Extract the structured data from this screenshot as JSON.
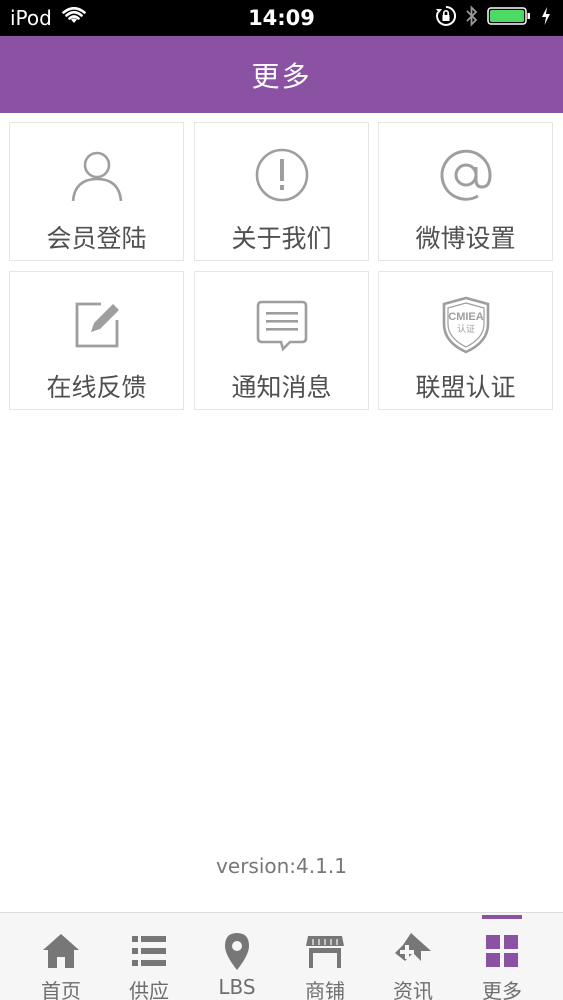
{
  "status_bar": {
    "carrier": "iPod",
    "time": "14:09"
  },
  "header": {
    "title": "更多",
    "color": "#8b51a2"
  },
  "grid": [
    {
      "label": "会员登陆",
      "icon": "user-icon"
    },
    {
      "label": "关于我们",
      "icon": "exclamation-circle-icon"
    },
    {
      "label": "微博设置",
      "icon": "at-sign-icon"
    },
    {
      "label": "在线反馈",
      "icon": "edit-icon"
    },
    {
      "label": "通知消息",
      "icon": "message-icon"
    },
    {
      "label": "联盟认证",
      "icon": "cmiea-badge-icon",
      "badge_text": "CMIEA",
      "badge_sub": "认证"
    }
  ],
  "version": "version:4.1.1",
  "tabbar": {
    "active_index": 5,
    "active_color": "#8b51a2",
    "items": [
      {
        "label": "首页",
        "icon": "home-icon"
      },
      {
        "label": "供应",
        "icon": "list-icon"
      },
      {
        "label": "LBS",
        "icon": "location-pin-icon"
      },
      {
        "label": "商铺",
        "icon": "store-icon"
      },
      {
        "label": "资讯",
        "icon": "news-icon"
      },
      {
        "label": "更多",
        "icon": "grid-icon"
      }
    ]
  }
}
